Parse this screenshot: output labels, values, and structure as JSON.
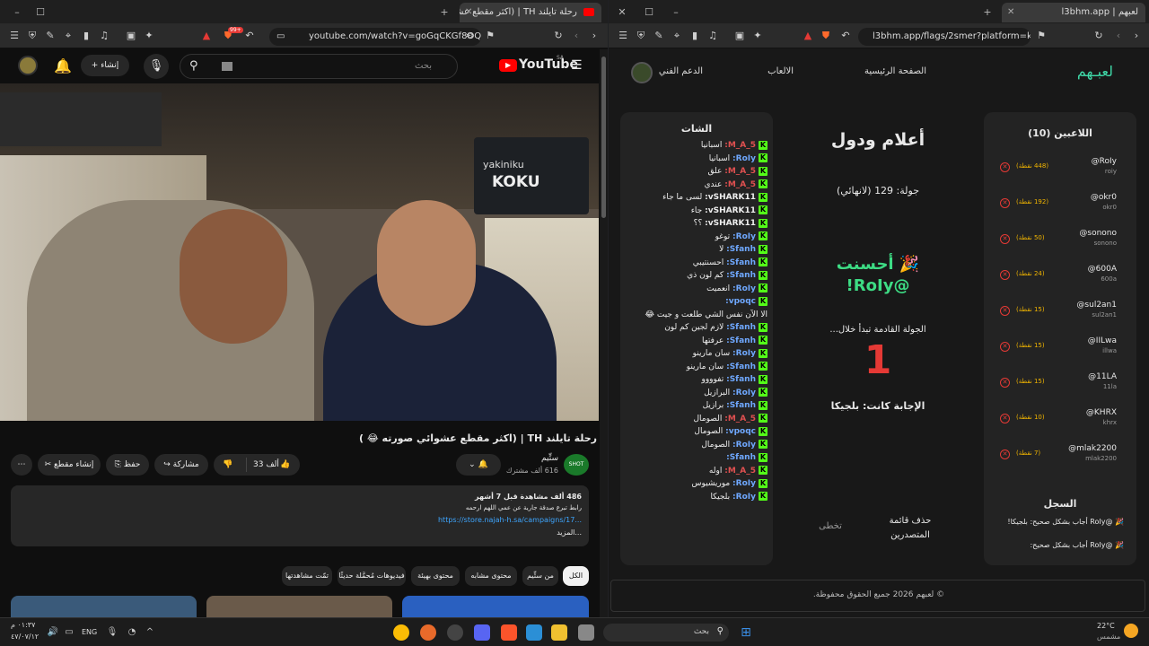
{
  "left_browser": {
    "tab_title": "رحلة تايلند TH | (اكثر مقطع عشـ",
    "url": "youtube.com/watch?v=goGqCKGf8OQ",
    "badge": "99+"
  },
  "youtube": {
    "logo_text": "YouTube",
    "region": "SA",
    "search_placeholder": "بحث",
    "create_label": "إنشاء",
    "video_title": "رحلة تايلند TH | (اكثر مقطع عشوائي صورته 😂 )",
    "channel_name": "ستِّيم",
    "subscribers": "616 ألف مشترك",
    "likes": "33 ألف",
    "share_label": "مشاركة",
    "save_label": "حفظ",
    "clip_label": "إنشاء مقطع",
    "desc_stats": "486 ألف مشاهدة قبل 7 أشهر",
    "desc_line": "رابط تبرع صدقة جارية عن عمي اللهم ارحمه",
    "desc_link": "https://store.najah-h.sa/campaigns/17...",
    "desc_more": "...المزيد",
    "chips": [
      "الكل",
      "من ستِّيم",
      "محتوى مشابه",
      "محتوى بهيئة",
      "فيديوهات مُحمَّلة حديثًا",
      "تمّت مشاهدتها"
    ]
  },
  "right_browser": {
    "tab_title": "لعبهم | l3bhm.app",
    "url": "l3bhm.app/flags/2smer?platform=kick"
  },
  "game": {
    "logo": "لعبـهم",
    "nav": [
      "الصفحة الرئيسية",
      "الالعاب",
      "الدعم الفني"
    ],
    "players_title": "اللاعبين (10)",
    "players": [
      {
        "name": "@RoIy",
        "sub": "roiy",
        "points": "(448 نقطة)"
      },
      {
        "name": "@okr0",
        "sub": "okr0",
        "points": "(192 نقطة)"
      },
      {
        "name": "@sonono",
        "sub": "sonono",
        "points": "(50 نقطة)"
      },
      {
        "name": "@600A",
        "sub": "600a",
        "points": "(24 نقطة)"
      },
      {
        "name": "@sul2an1",
        "sub": "sul2an1",
        "points": "(15 نقطة)"
      },
      {
        "name": "@IILwa",
        "sub": "illwa",
        "points": "(15 نقطة)"
      },
      {
        "name": "@11LA",
        "sub": "11la",
        "points": "(15 نقطة)"
      },
      {
        "name": "@KHRX",
        "sub": "khrx",
        "points": "(10 نقطة)"
      },
      {
        "name": "@mlak2200",
        "sub": "mlak2200",
        "points": "(7 نقطة)"
      }
    ],
    "log_title": "السجل",
    "log": [
      "🎉 @RoIy أجاب بشكل صحيح: بلجيكا!",
      "🎉 @RoIy أجاب بشكل صحيح:"
    ],
    "game_title": "أعلام ودول",
    "round": "جولة: 129 (لانهائي)",
    "well_done": "🎉 أحسنت",
    "winner": "@RoIy!",
    "next_round": "الجولة القادمة تبدأ خلال...",
    "countdown": "1",
    "answer": "الإجابة كانت: بلجيكا",
    "delete_board": "حذف قائمة المتصدرين",
    "skip": "تخطى",
    "chat_title": "الشات",
    "chat": [
      {
        "u": "M_A_5:",
        "m": "اسبانيا",
        "c": "#e05050"
      },
      {
        "u": "RoIy:",
        "m": "اسبانيا",
        "c": "#6fa8ff"
      },
      {
        "u": "M_A_5:",
        "m": "علق",
        "c": "#e05050"
      },
      {
        "u": "M_A_5:",
        "m": "عندي",
        "c": "#e05050"
      },
      {
        "u": "vSHARK11:",
        "m": "لسى ما جاء",
        "c": "#eeeeee"
      },
      {
        "u": "vSHARK11:",
        "m": "جاء",
        "c": "#eeeeee"
      },
      {
        "u": "vSHARK11:",
        "m": "؟؟",
        "c": "#eeeeee"
      },
      {
        "u": "RoIy:",
        "m": "توغو",
        "c": "#6fa8ff"
      },
      {
        "u": "Sfanh:",
        "m": "لا",
        "c": "#6fa8ff"
      },
      {
        "u": "Sfanh:",
        "m": "احسنتيبي",
        "c": "#6fa8ff"
      },
      {
        "u": "Sfanh:",
        "m": "كم لون ذي",
        "c": "#6fa8ff"
      },
      {
        "u": "RoIy:",
        "m": "انعميت",
        "c": "#6fa8ff"
      },
      {
        "u": "vpoqc:",
        "m": "",
        "c": "#6fa8ff"
      },
      {
        "u": "",
        "m": "الا الآن نفس الشي طلعت و جيت 😂",
        "c": "#eeeeee"
      },
      {
        "u": "Sfanh:",
        "m": "لازم لجين كم لون",
        "c": "#6fa8ff"
      },
      {
        "u": "Sfanh:",
        "m": "عرفتها",
        "c": "#6fa8ff"
      },
      {
        "u": "RoIy:",
        "m": "سان مارينو",
        "c": "#6fa8ff"
      },
      {
        "u": "Sfanh:",
        "m": "سان مارينو",
        "c": "#6fa8ff"
      },
      {
        "u": "Sfanh:",
        "m": "تفوووو",
        "c": "#6fa8ff"
      },
      {
        "u": "RoIy:",
        "m": "البرازيل",
        "c": "#6fa8ff"
      },
      {
        "u": "Sfanh:",
        "m": "برازيل",
        "c": "#6fa8ff"
      },
      {
        "u": "M_A_5:",
        "m": "الصومال",
        "c": "#e05050"
      },
      {
        "u": "vpoqc:",
        "m": "الصومال",
        "c": "#6fa8ff"
      },
      {
        "u": "RoIy:",
        "m": "الصومال",
        "c": "#6fa8ff"
      },
      {
        "u": "Sfanh:",
        "m": "",
        "c": "#6fa8ff"
      },
      {
        "u": "M_A_5:",
        "m": "اوله",
        "c": "#e05050"
      },
      {
        "u": "RoIy:",
        "m": "موريشيوس",
        "c": "#6fa8ff"
      },
      {
        "u": "RoIy:",
        "m": "بلجيكا",
        "c": "#6fa8ff"
      }
    ],
    "footer": "© لعبهم 2026 جميع الحقوق محفوظة."
  },
  "taskbar": {
    "weather_temp": "22°C",
    "weather_desc": "مشمس",
    "search": "بحث",
    "lang": "ENG",
    "time": "٠١:٣٧ م",
    "date": "٤٧/٠٧/١٢"
  },
  "colors": {
    "kick_green": "#53fc18",
    "accent_red": "#e53935",
    "win_green": "#3ddc84"
  }
}
